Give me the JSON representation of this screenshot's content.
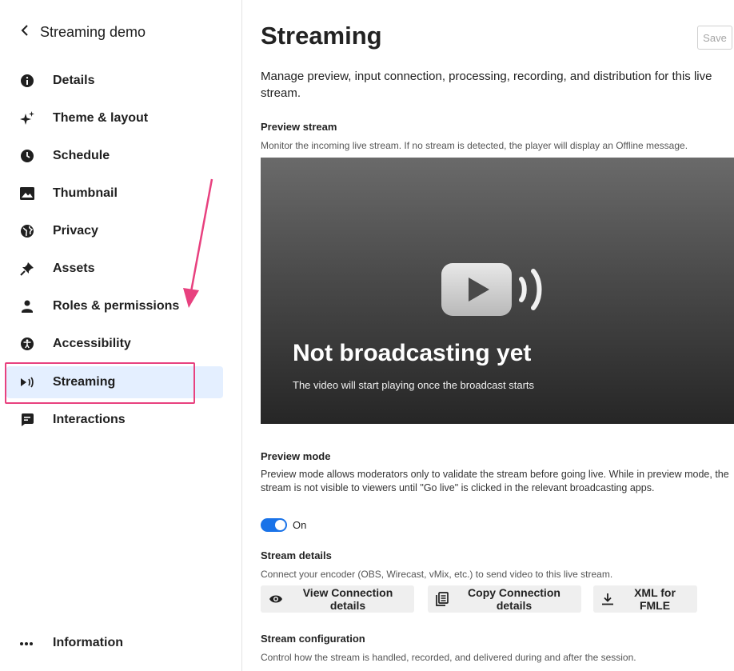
{
  "sidebar": {
    "back_label": "Streaming demo",
    "items": [
      {
        "label": "Details",
        "icon": "info-circle-icon"
      },
      {
        "label": "Theme & layout",
        "icon": "sparkle-icon"
      },
      {
        "label": "Schedule",
        "icon": "clock-icon"
      },
      {
        "label": "Thumbnail",
        "icon": "image-icon"
      },
      {
        "label": "Privacy",
        "icon": "globe-icon"
      },
      {
        "label": "Assets",
        "icon": "pin-icon"
      },
      {
        "label": "Roles & permissions",
        "icon": "person-icon"
      },
      {
        "label": "Accessibility",
        "icon": "accessibility-icon"
      },
      {
        "label": "Streaming",
        "icon": "broadcast-icon",
        "active": true
      },
      {
        "label": "Interactions",
        "icon": "chat-icon"
      }
    ],
    "info_label": "Information",
    "info_icon": "more-icon"
  },
  "main": {
    "title": "Streaming",
    "save_label": "Save",
    "intro": "Manage preview, input connection, processing, recording, and distribution for this live stream.",
    "preview": {
      "title": "Preview stream",
      "desc": "Monitor the incoming live stream. If no stream is detected, the player will display an Offline message.",
      "player_title": "Not broadcasting yet",
      "player_sub": "The video will start playing once the broadcast starts"
    },
    "preview_mode": {
      "title": "Preview mode",
      "desc": "Preview mode allows moderators only to validate the stream before going live. While in preview mode, the stream is not visible to viewers until \"Go live\" is clicked in the relevant broadcasting apps.",
      "toggle_label": "On",
      "toggle_on": true
    },
    "stream_details": {
      "title": "Stream details",
      "desc": "Connect your encoder (OBS, Wirecast, vMix, etc.) to send video to this live stream.",
      "buttons": [
        {
          "label": "View Connection details",
          "icon": "eye-icon"
        },
        {
          "label": "Copy Connection details",
          "icon": "copy-icon"
        },
        {
          "label": "XML for FMLE",
          "icon": "download-icon"
        }
      ]
    },
    "stream_config": {
      "title": "Stream configuration",
      "desc": "Control how the stream is handled, recorded, and delivered during and after the session."
    }
  },
  "colors": {
    "accent": "#1a73e8",
    "active_bg": "#e4efff",
    "annotation": "#e8417f"
  }
}
